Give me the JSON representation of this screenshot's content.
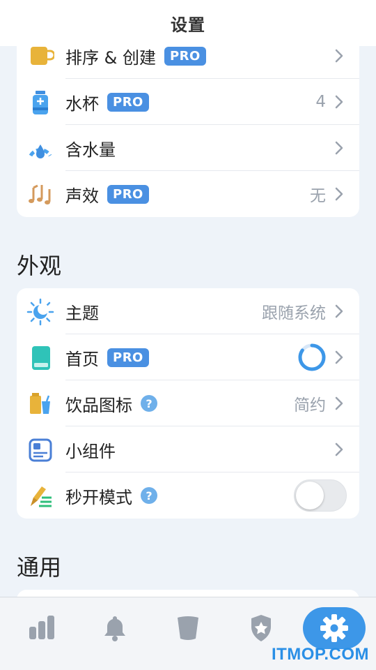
{
  "header": {
    "title": "设置"
  },
  "group1": {
    "rows": [
      {
        "label": "排序 & 创建",
        "pro": "PRO",
        "value": ""
      },
      {
        "label": "水杯",
        "pro": "PRO",
        "value": "4"
      },
      {
        "label": "含水量",
        "pro": "",
        "value": ""
      },
      {
        "label": "声效",
        "pro": "PRO",
        "value": "无"
      }
    ]
  },
  "appearance": {
    "title": "外观",
    "rows": [
      {
        "label": "主题",
        "pro": "",
        "value": "跟随系统"
      },
      {
        "label": "首页",
        "pro": "PRO",
        "value": "",
        "progress": 0.85
      },
      {
        "label": "饮品图标",
        "help": "?",
        "value": "简约"
      },
      {
        "label": "小组件",
        "value": ""
      },
      {
        "label": "秒开模式",
        "help": "?",
        "toggle": false
      }
    ]
  },
  "general": {
    "title": "通用"
  },
  "tabbar": {
    "tabs": [
      {
        "icon": "bar-chart-icon"
      },
      {
        "icon": "bell-icon"
      },
      {
        "icon": "cup-icon"
      },
      {
        "icon": "star-shield-icon"
      },
      {
        "icon": "gear-icon"
      }
    ],
    "active": 4
  },
  "watermark": "ITMOP.COM",
  "colors": {
    "accent": "#4a90e2",
    "tab_active": "#3d97e8",
    "background": "#eef3f9"
  }
}
